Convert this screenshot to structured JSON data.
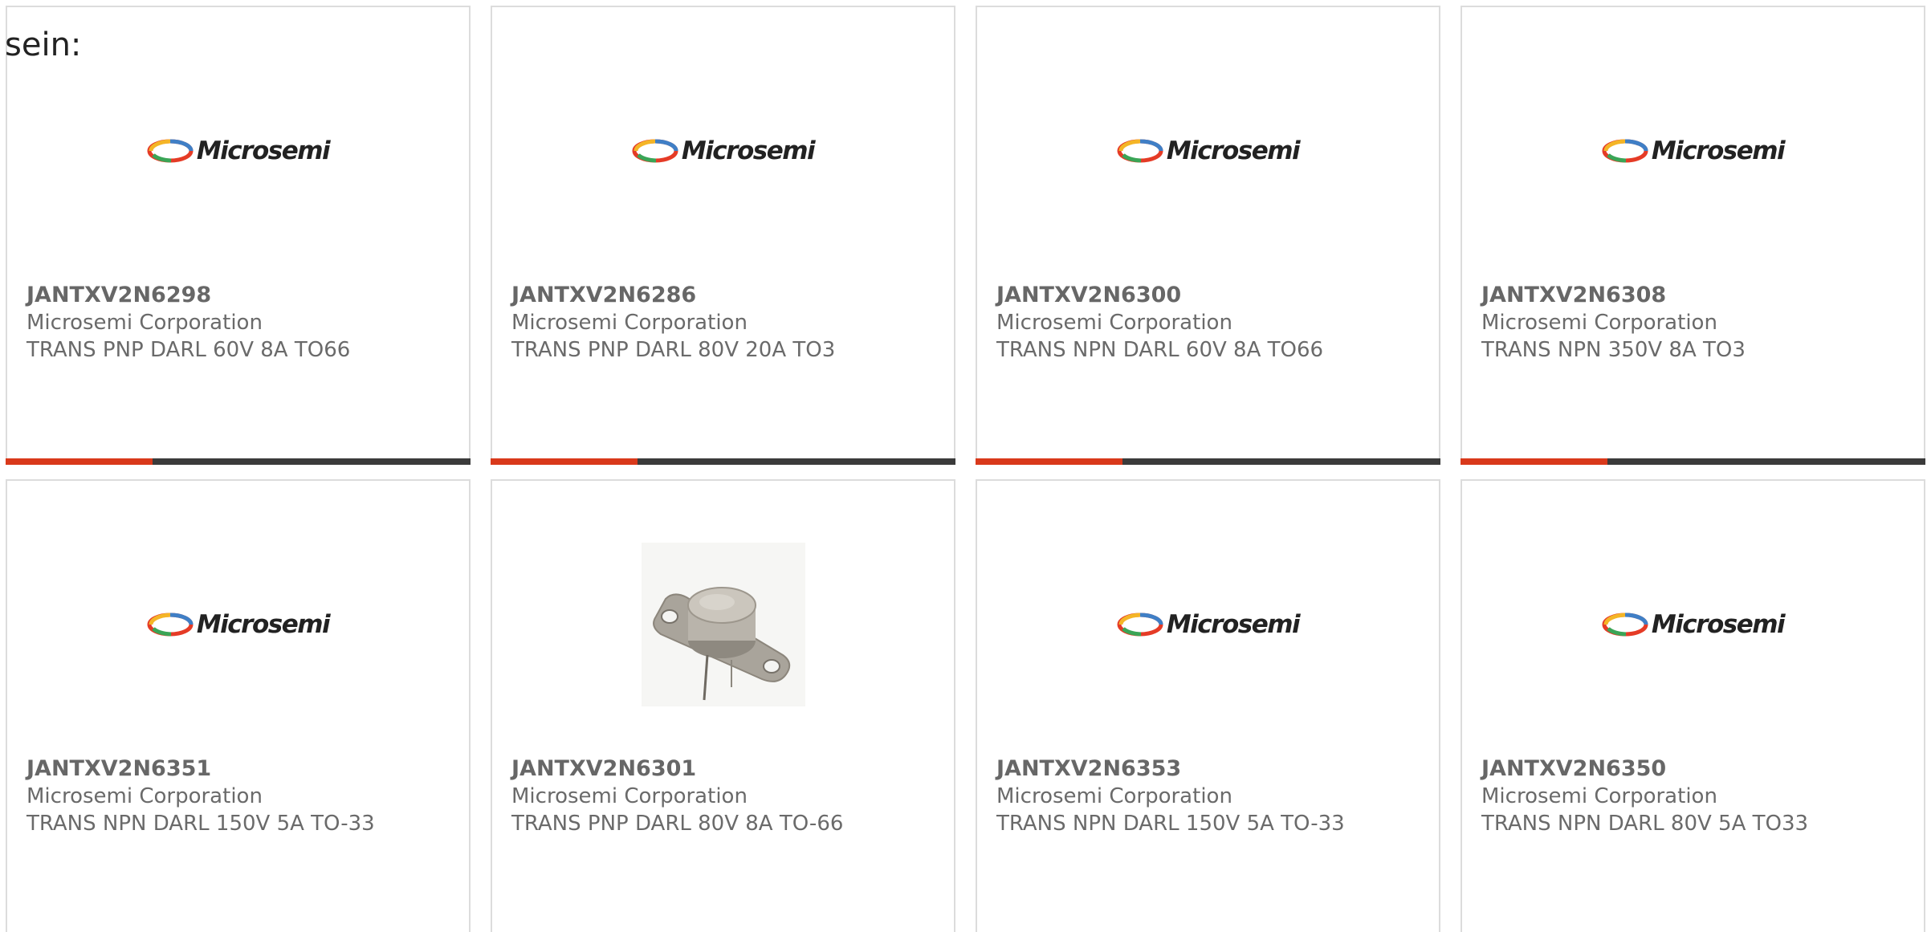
{
  "intro_text": "sein:",
  "colors": {
    "accent": "#d9391b",
    "bar": "#3b3b3b",
    "border": "#dcdcdc",
    "text": "#666666"
  },
  "products": [
    {
      "part_number": "JANTXV2N6298",
      "manufacturer": "Microsemi Corporation",
      "description": "TRANS PNP DARL 60V 8A TO66",
      "image": "microsemi-logo",
      "logo_text": "Microsemi"
    },
    {
      "part_number": "JANTXV2N6286",
      "manufacturer": "Microsemi Corporation",
      "description": "TRANS PNP DARL 80V 20A TO3",
      "image": "microsemi-logo",
      "logo_text": "Microsemi"
    },
    {
      "part_number": "JANTXV2N6300",
      "manufacturer": "Microsemi Corporation",
      "description": "TRANS NPN DARL 60V 8A TO66",
      "image": "microsemi-logo",
      "logo_text": "Microsemi"
    },
    {
      "part_number": "JANTXV2N6308",
      "manufacturer": "Microsemi Corporation",
      "description": "TRANS NPN 350V 8A TO3",
      "image": "microsemi-logo",
      "logo_text": "Microsemi"
    },
    {
      "part_number": "JANTXV2N6351",
      "manufacturer": "Microsemi Corporation",
      "description": "TRANS NPN DARL 150V 5A TO-33",
      "image": "microsemi-logo",
      "logo_text": "Microsemi"
    },
    {
      "part_number": "JANTXV2N6301",
      "manufacturer": "Microsemi Corporation",
      "description": "TRANS PNP DARL 80V 8A TO-66",
      "image": "transistor-photo",
      "logo_text": ""
    },
    {
      "part_number": "JANTXV2N6353",
      "manufacturer": "Microsemi Corporation",
      "description": "TRANS NPN DARL 150V 5A TO-33",
      "image": "microsemi-logo",
      "logo_text": "Microsemi"
    },
    {
      "part_number": "JANTXV2N6350",
      "manufacturer": "Microsemi Corporation",
      "description": "TRANS NPN DARL 80V 5A TO33",
      "image": "microsemi-logo",
      "logo_text": "Microsemi"
    }
  ]
}
